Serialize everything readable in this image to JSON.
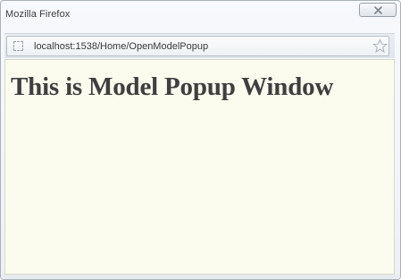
{
  "window": {
    "title": "Mozilla Firefox"
  },
  "address_bar": {
    "url": "localhost:1538/Home/OpenModelPopup"
  },
  "page": {
    "heading": "This is Model Popup Window"
  },
  "icons": {
    "close": "close-icon",
    "site": "site-identity-icon",
    "bookmark": "bookmark-star-icon"
  },
  "colors": {
    "content_background": "#fbfbee",
    "heading_text": "#3f3f3f",
    "window_frame": "#edf1f6"
  }
}
